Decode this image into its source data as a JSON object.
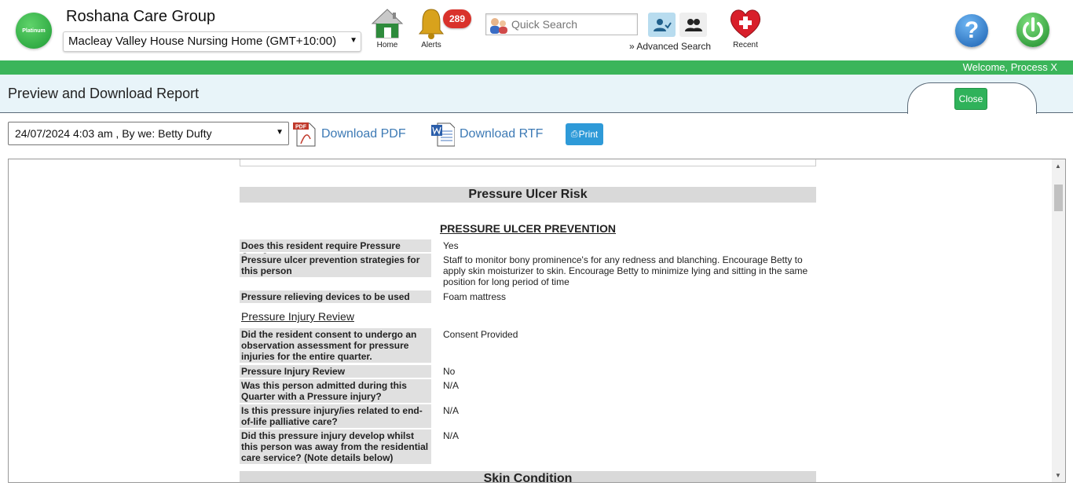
{
  "header": {
    "logo_text": "Platinum",
    "org_name": "Roshana Care Group",
    "facility": "Macleay Valley House Nursing Home (GMT+10:00)",
    "home_label": "Home",
    "alerts_label": "Alerts",
    "alerts_count": "289",
    "search_placeholder": "Quick Search",
    "advanced_search": "» Advanced Search",
    "recent_label": "Recent",
    "help_symbol": "?"
  },
  "welcome": "Welcome, Process X",
  "page": {
    "title": "Preview and Download Report",
    "close_label": "Close"
  },
  "toolbar": {
    "report_selected": "24/07/2024 4:03 am , By we: Betty Dufty",
    "download_pdf": "Download PDF",
    "download_rtf": "Download RTF",
    "print_label": "Print",
    "pdf_tag": "PDF"
  },
  "report": {
    "section1": "Pressure Ulcer Risk",
    "subsection": "PRESSURE ULCER PREVENTION",
    "rows1": [
      {
        "q": "Does this resident require Pressure Care?",
        "a": "Yes"
      },
      {
        "q": "Pressure ulcer prevention strategies for this person",
        "a": "Staff to monitor bony prominence's for any redness and blanching. Encourage Betty to apply skin moisturizer to skin. Encourage Betty to minimize lying and sitting in the same position for long period of time"
      },
      {
        "q": "Pressure relieving devices to be used",
        "a": "Foam mattress"
      }
    ],
    "review_label": "Pressure Injury Review",
    "rows2": [
      {
        "q": "Did the resident consent to undergo an observation assessment for pressure injuries for the entire quarter.",
        "a": "Consent Provided"
      },
      {
        "q": "Pressure Injury Review",
        "a": "No"
      },
      {
        "q": "Was this person admitted during this Quarter with a Pressure injury?",
        "a": "N/A"
      },
      {
        "q": "Is this pressure injury/ies related to end-of-life palliative care?",
        "a": "N/A"
      },
      {
        "q": "Did this pressure injury develop whilst this person was away from the residential care service? (Note details below)",
        "a": "N/A"
      }
    ],
    "section2": "Skin Condition"
  }
}
